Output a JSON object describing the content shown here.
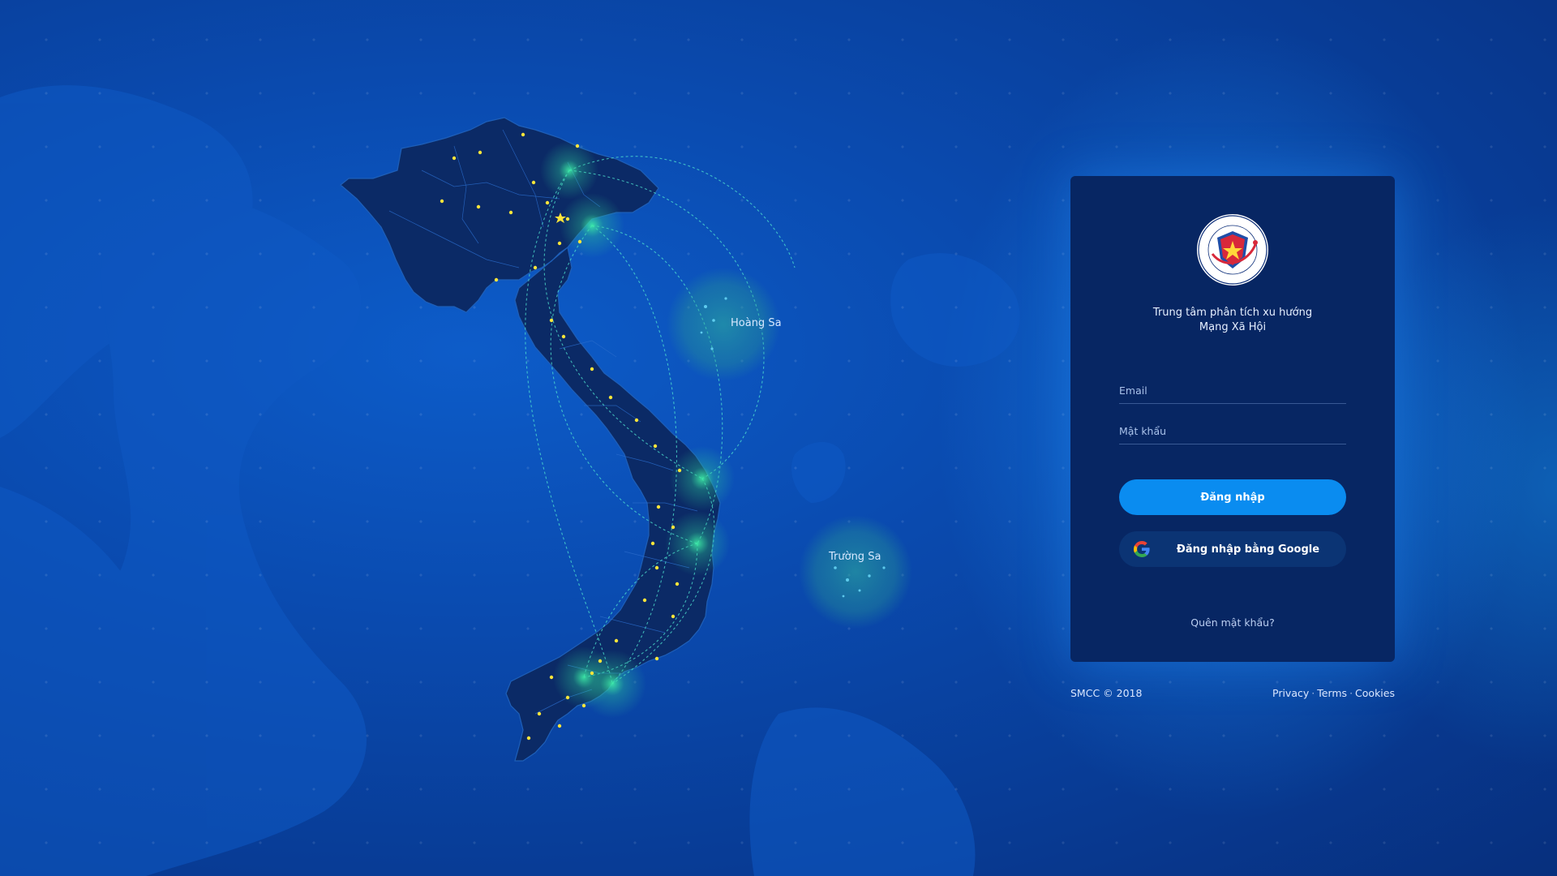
{
  "map": {
    "labels": {
      "hoang_sa": "Hoàng Sa",
      "truong_sa": "Trường Sa"
    }
  },
  "login": {
    "subtitle_line1": "Trung tâm phân tích xu hướng",
    "subtitle_line2": "Mạng Xã Hội",
    "email_placeholder": "Email",
    "password_placeholder": "Mật khẩu",
    "login_label": "Đăng nhập",
    "google_label": "Đăng nhập bằng Google",
    "forgot_label": "Quên mật khẩu?"
  },
  "footer": {
    "copyright": "SMCC © 2018",
    "links": [
      "Privacy",
      "Terms",
      "Cookies"
    ]
  },
  "colors": {
    "background": "#0a4bb0",
    "card": "#072663",
    "primary_button": "#0a8cf0",
    "google_button": "#0b3474",
    "map_fill": "#0b2a66",
    "glow": "#2ee6a0",
    "arc": "#4fe3d0"
  },
  "icons": {
    "logo": "vietnam-cyber-security-center-logo",
    "google": "google-g-icon"
  }
}
